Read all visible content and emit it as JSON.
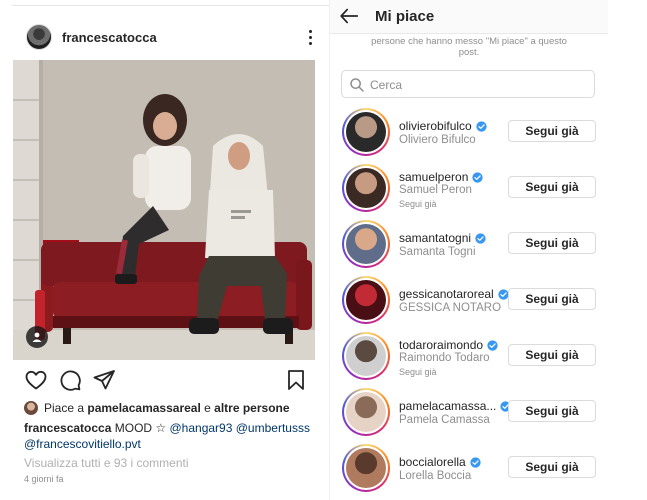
{
  "post": {
    "username": "francescatocca",
    "liked_by_prefix": "Piace a",
    "liked_by_user": "pamelacamassareal",
    "liked_by_conj": "e",
    "liked_by_others": "altre persone",
    "caption_user": "francescatocca",
    "caption_text": "MOOD ☆",
    "caption_tag1": "@hangar93",
    "caption_tag2": "@umbertusss",
    "caption_tag3": "@francescovitiello.pvt",
    "view_comments": "Visualizza tutti e 93 i commenti",
    "time_ago": "4 giorni fa"
  },
  "likes_screen": {
    "title": "Mi piace",
    "subnote": "persone che hanno messo \"Mi piace\" a questo post.",
    "search_placeholder": "Cerca",
    "button_label": "Segui già"
  },
  "users": [
    {
      "username": "olivierobifulco",
      "full_name": "Oliviero Bifulco",
      "sub": "",
      "avatar": [
        "#2a2a2a",
        "#b89a86"
      ]
    },
    {
      "username": "samuelperon",
      "full_name": "Samuel Peron",
      "sub": "Segui già",
      "avatar": [
        "#3b2a24",
        "#c79b82"
      ]
    },
    {
      "username": "samantatogni",
      "full_name": "Samanta Togni",
      "sub": "",
      "avatar": [
        "#5f6d8a",
        "#d8a888"
      ]
    },
    {
      "username": "gessicanotaroreal",
      "full_name": "GESSICA NOTARO",
      "sub": "",
      "avatar": [
        "#4a0f14",
        "#c22a36"
      ]
    },
    {
      "username": "todaroraimondo",
      "full_name": "Raimondo Todaro",
      "sub": "Segui già",
      "avatar": [
        "#cfcfcf",
        "#5a4a40"
      ]
    },
    {
      "username": "pamelacamassa...",
      "full_name": "Pamela Camassa",
      "sub": "",
      "avatar": [
        "#e7d3c6",
        "#8a6a58"
      ]
    },
    {
      "username": "boccialorella",
      "full_name": "Lorella Boccia",
      "sub": "",
      "avatar": [
        "#b07a5e",
        "#5a3a2c"
      ]
    }
  ]
}
